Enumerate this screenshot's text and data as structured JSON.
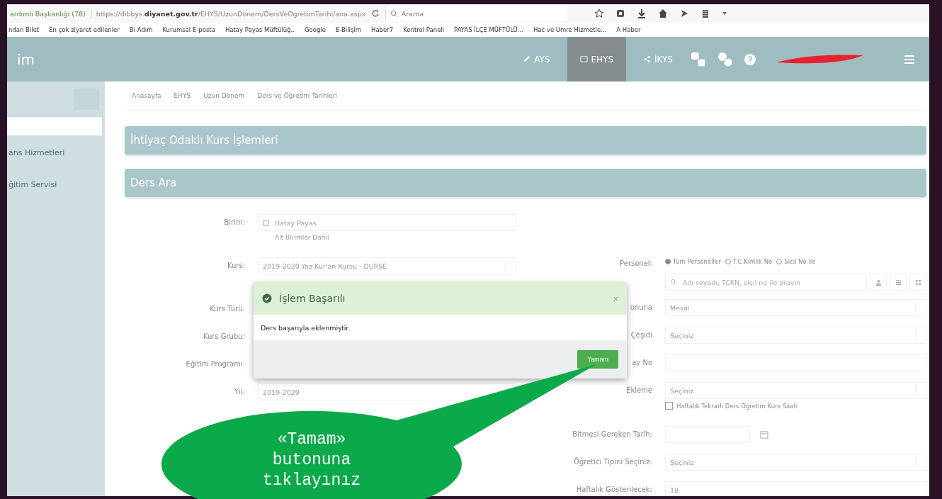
{
  "browser": {
    "tab_title": "ardımlı Başkanlığı (78)",
    "url_prefix": "https://dibbys.",
    "url_domain": "diyanet.gov.tr",
    "url_path": "/EHYS/UzunDonem/DersVeOgretimTarihi/ana.aspx",
    "search_placeholder": "Arama",
    "bookmarks": [
      "ndan Bilet",
      "En çok ziyaret edilenler",
      "Bi Adım",
      "Kurumsal E-posta",
      "Hatay Payas Müftülüğ..",
      "Google",
      "E-Bilişim",
      "Haber7",
      "Kontrol Paneli",
      "PAYAS İLÇE MÜFTÜLÜ...",
      "Hac ve Umre Hizmetle...",
      "A Haber"
    ]
  },
  "nav": {
    "logo": "im",
    "items": [
      {
        "label": "AYS",
        "selected": false
      },
      {
        "label": "EHYS",
        "selected": true
      },
      {
        "label": "İKYS",
        "selected": false
      }
    ]
  },
  "sidebar": {
    "items": [
      "ans Hizmetleri",
      "ğitim Servisi"
    ]
  },
  "breadcrumb": [
    "Anasayfa",
    "EHYS",
    "Uzun Dönem",
    "Ders ve Öğretim Tarihleri"
  ],
  "panels": [
    "İhtiyaç Odaklı Kurs İşlemleri",
    "Ders Ara"
  ],
  "left_form": [
    {
      "label": "Birim:",
      "kind": "unit",
      "value": "Hatay Payas",
      "sub": "Alt Birimler Dahil"
    },
    {
      "label": "Kurs:",
      "kind": "select",
      "value": "2019-2020 Yaz Kur'an Kursu - DURSE"
    },
    {
      "label": "Kurs Türü:",
      "kind": "covered"
    },
    {
      "label": "Kurs Grubu:",
      "kind": "covered"
    },
    {
      "label": "Eğitim Programı:",
      "kind": "covered"
    },
    {
      "label": "Yıl:",
      "kind": "text",
      "value": "2019-2020"
    }
  ],
  "right_form": [
    {
      "label": "Personel:",
      "kind": "radios",
      "options": [
        {
          "label": "Tüm Personeller",
          "selected": true
        },
        {
          "label": "T.C.Kimlik No",
          "selected": false
        },
        {
          "label": "Sicil No ile",
          "selected": false
        }
      ]
    },
    {
      "kind": "search",
      "placeholder": "Adı soyadı, TCKN, sicil no ile arayın"
    },
    {
      "label": "onuna",
      "kind": "select",
      "value": "Mesai"
    },
    {
      "label": "Çeşidi",
      "kind": "select",
      "value": "Seçiniz"
    },
    {
      "label": "ay No",
      "kind": "input"
    },
    {
      "label": "Ekleme",
      "kind": "select",
      "value": "Seçiniz",
      "check": {
        "label": "Haftalık Tekrarlı Ders Öğretim Kurs Saati",
        "checked": false
      }
    },
    {
      "label": "Bitmesi Gereken Tarih:",
      "kind": "date"
    },
    {
      "label": "Öğretici Tipini Seçiniz:",
      "kind": "select",
      "value": "Seçiniz"
    },
    {
      "label": "Haftalık Gösterilecek:",
      "kind": "text",
      "value": "18"
    }
  ],
  "modal": {
    "title": "İşlem Başarılı",
    "close": "×",
    "message": "Ders başarıyla eklenmiştir.",
    "button": "Tamam"
  },
  "callout": {
    "lines": [
      "«Tamam»",
      "butonuna",
      "tıklayınız"
    ]
  }
}
